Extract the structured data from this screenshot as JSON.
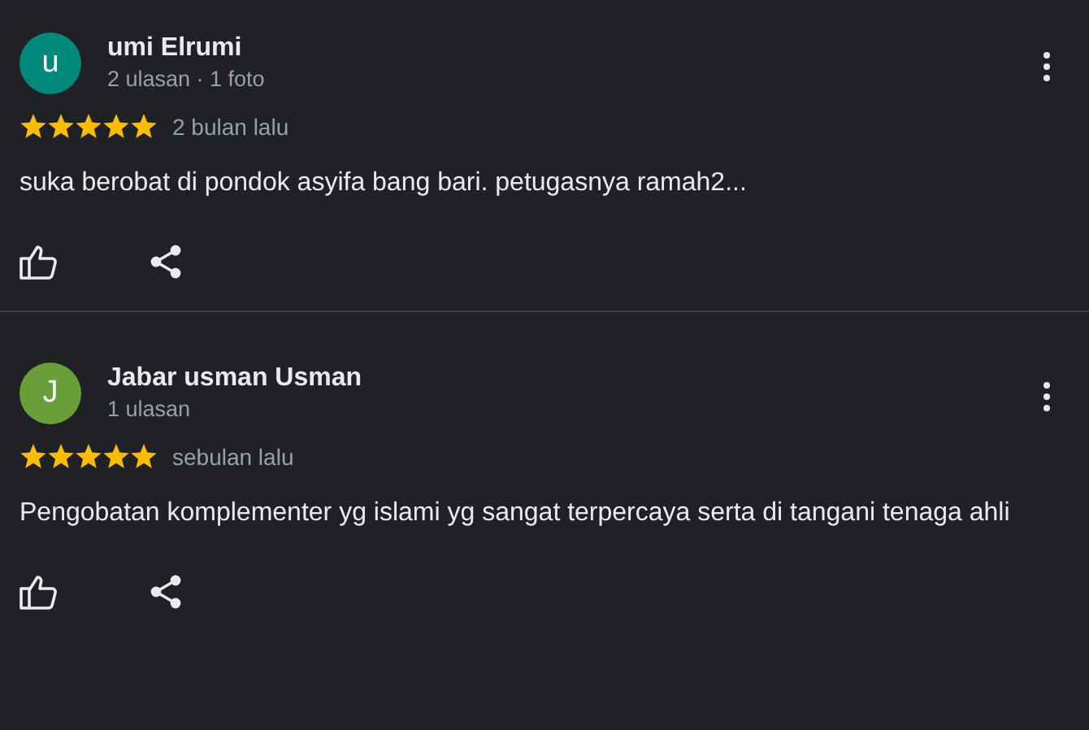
{
  "reviews": [
    {
      "avatar_letter": "u",
      "color": "#00897b",
      "name": "umi Elrumi",
      "meta": "2 ulasan · 1 foto",
      "stars": 5,
      "date": "2 bulan lalu",
      "text": "suka berobat di pondok asyifa bang bari. petugasnya ramah2..."
    },
    {
      "avatar_letter": "J",
      "color": "#689f38",
      "name": "Jabar usman Usman",
      "meta": "1 ulasan",
      "stars": 5,
      "date": "sebulan lalu",
      "text": "Pengobatan komplementer yg islami yg sangat terpercaya serta di tangani tenaga ahli"
    }
  ]
}
